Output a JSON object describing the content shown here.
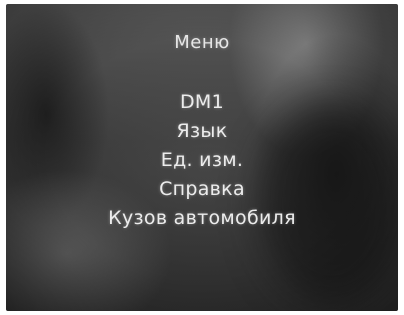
{
  "menu": {
    "title": "Меню",
    "items": [
      {
        "label": "DM1"
      },
      {
        "label": "Язык"
      },
      {
        "label": "Ед. изм."
      },
      {
        "label": "Справка"
      },
      {
        "label": "Кузов автомобиля"
      }
    ]
  }
}
